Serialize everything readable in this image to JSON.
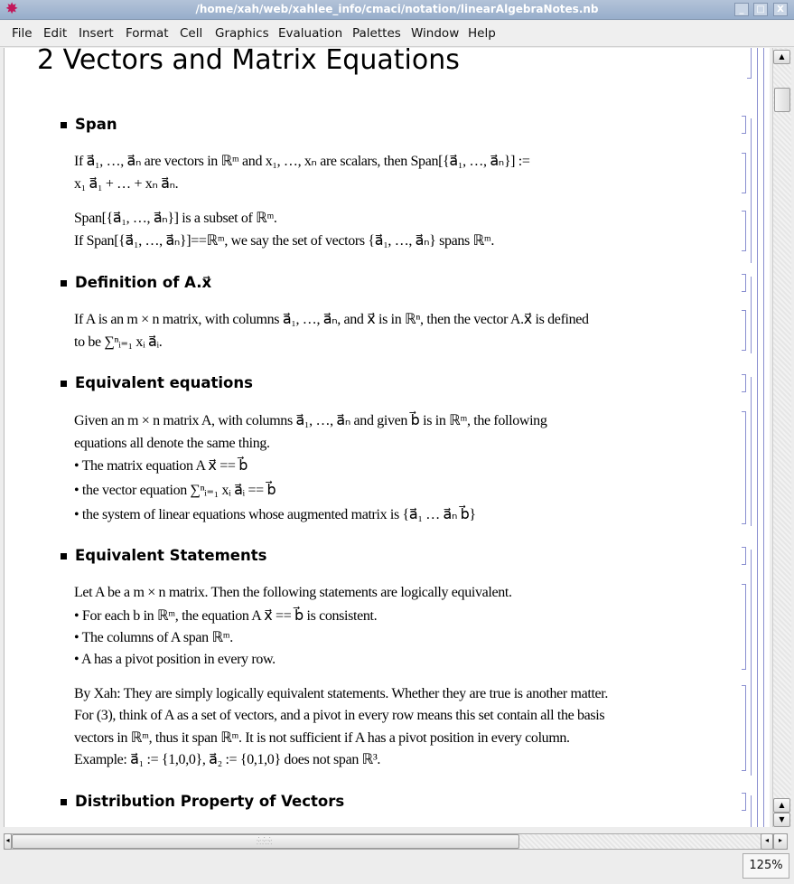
{
  "window": {
    "title": "/home/xah/web/xahlee_info/cmaci/notation/linearAlgebraNotes.nb",
    "icon": "mathematica-star-icon",
    "buttons": [
      "minimize",
      "maximize",
      "close"
    ]
  },
  "menu": [
    "File",
    "Edit",
    "Insert",
    "Format",
    "Cell",
    "Graphics",
    "Evaluation",
    "Palettes",
    "Window",
    "Help"
  ],
  "doc": {
    "title": "2 Vectors and Matrix Equations",
    "sections": [
      {
        "heading": "Span",
        "lines": [
          "If a⃗₁,  …,  a⃗ₙ are vectors in ℝᵐ and x₁,  …,  xₙ are scalars, then Span[{a⃗₁,  …,  a⃗ₙ}] :=",
          "x₁ a⃗₁ + … + xₙ a⃗ₙ.",
          "Span[{a⃗₁,  …,  a⃗ₙ}] is a subset of ℝᵐ.",
          "If Span[{a⃗₁,  …,  a⃗ₙ}]==ℝᵐ, we say the set of vectors {a⃗₁,  …,  a⃗ₙ} spans ℝᵐ."
        ]
      },
      {
        "heading": "Definition of A.x⃗",
        "lines": [
          "If A is an m × n matrix, with columns a⃗₁,  …,  a⃗ₙ, and x⃗ is in ℝⁿ, then the vector A.x⃗ is defined",
          "to be ∑ⁿᵢ₌₁ xᵢ a⃗ᵢ."
        ]
      },
      {
        "heading": "Equivalent equations",
        "lines": [
          "Given an m × n matrix A, with columns a⃗₁,  …,  a⃗ₙ and given b⃗ is in ℝᵐ, the following",
          "equations all denote the same thing.",
          "• The matrix equation A x⃗ == b⃗",
          "• the vector equation ∑ⁿᵢ₌₁ xᵢ a⃗ᵢ == b⃗",
          "• the system of linear equations whose augmented matrix is {a⃗₁ … a⃗ₙ b⃗}"
        ]
      },
      {
        "heading": "Equivalent Statements",
        "lines": [
          "Let A be a m × n matrix. Then the following statements are logically equivalent.",
          "• For each b in ℝᵐ, the equation A x⃗ == b⃗ is consistent.",
          "• The columns of A span ℝᵐ.",
          "• A has a pivot position in every row.",
          "By Xah: They are simply logically equivalent statements. Whether they are true is another matter.",
          "For (3), think of A as a set of vectors, and a pivot in every row means this set contain all the basis",
          "vectors in ℝᵐ, thus it span ℝᵐ. It is not sufficient if A has a pivot position in every column.",
          "Example: a⃗₁ := {1,0,0}, a⃗₂ := {0,1,0} does not span ℝ³."
        ]
      },
      {
        "heading": "Distribution Property of Vectors",
        "lines": []
      }
    ]
  },
  "status": {
    "zoom": "125%"
  }
}
